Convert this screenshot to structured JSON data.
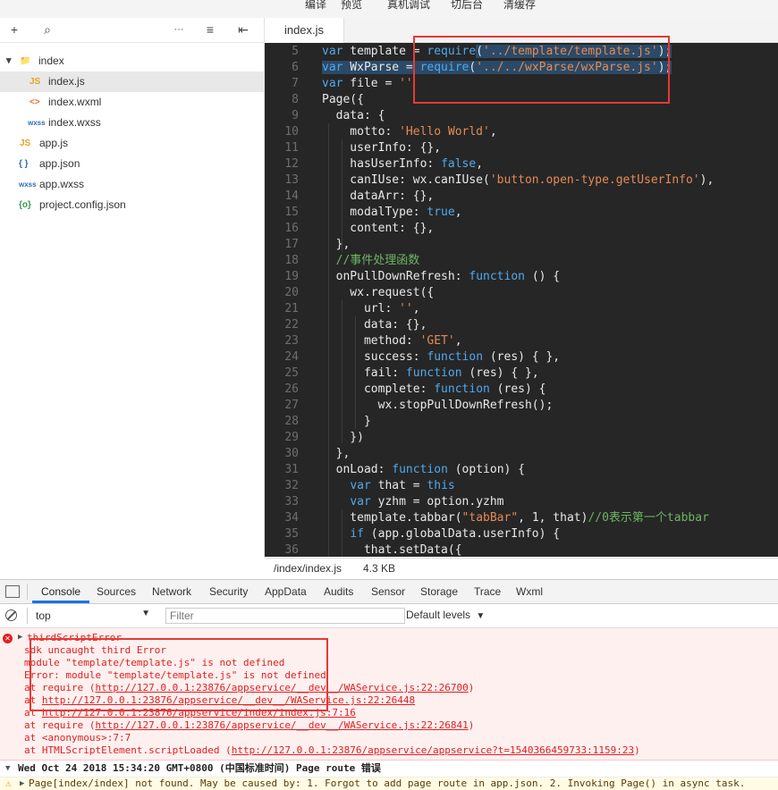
{
  "top_menu": [
    "编译",
    "预览",
    "真机调试",
    "切后台",
    "清缓存"
  ],
  "sidebar": {
    "toolbar": [
      "+",
      "⌕",
      "···",
      "≡",
      "⇤"
    ],
    "tree": [
      {
        "label": "index",
        "icon": "📁",
        "arrow": "▾",
        "icon_color": "#555"
      },
      {
        "label": "index.js",
        "icon": "JS",
        "icon_color": "#e8a21a"
      },
      {
        "label": "index.wxml",
        "icon": "<>",
        "icon_color": "#e0703a"
      },
      {
        "label": "index.wxss",
        "icon": "wxss",
        "icon_color": "#2f6db5"
      },
      {
        "label": "app.js",
        "icon": "JS",
        "icon_color": "#e8a21a"
      },
      {
        "label": "app.json",
        "icon": "{ }",
        "icon_color": "#2f6db5"
      },
      {
        "label": "app.wxss",
        "icon": "wxss",
        "icon_color": "#2f6db5"
      },
      {
        "label": "project.config.json",
        "icon": "{o}",
        "icon_color": "#2f9a4b"
      }
    ]
  },
  "editor": {
    "tab": "index.js",
    "lines": [
      {
        "n": "5",
        "parts": [
          [
            "k",
            "var"
          ],
          [
            "t",
            " template = "
          ],
          [
            "k",
            "require"
          ],
          [
            "t",
            "("
          ],
          [
            "s",
            "'../template/template.js'"
          ],
          [
            "t",
            ");"
          ]
        ]
      },
      {
        "n": "6",
        "parts": [
          [
            "k",
            "var"
          ],
          [
            "t",
            " WxParse = "
          ],
          [
            "k",
            "require"
          ],
          [
            "t",
            "("
          ],
          [
            "s",
            "'../../wxParse/wxParse.js'"
          ],
          [
            "t",
            ");"
          ]
        ]
      },
      {
        "n": "7",
        "parts": [
          [
            "k",
            "var"
          ],
          [
            "t",
            " file = "
          ],
          [
            "s",
            "''"
          ]
        ]
      },
      {
        "n": "8",
        "parts": [
          [
            "t",
            "Page({"
          ]
        ]
      },
      {
        "n": "9",
        "parts": [
          [
            "t",
            "  data: {"
          ]
        ]
      },
      {
        "n": "10",
        "parts": [
          [
            "t",
            "    motto: "
          ],
          [
            "s",
            "'Hello World'"
          ],
          [
            "t",
            ","
          ]
        ]
      },
      {
        "n": "11",
        "parts": [
          [
            "t",
            "    userInfo: {},"
          ]
        ]
      },
      {
        "n": "12",
        "parts": [
          [
            "t",
            "    hasUserInfo: "
          ],
          [
            "k",
            "false"
          ],
          [
            "t",
            ","
          ]
        ]
      },
      {
        "n": "13",
        "parts": [
          [
            "t",
            "    canIUse: wx.canIUse("
          ],
          [
            "s",
            "'button.open-type.getUserInfo'"
          ],
          [
            "t",
            "),"
          ]
        ]
      },
      {
        "n": "14",
        "parts": [
          [
            "t",
            "    dataArr: {},"
          ]
        ]
      },
      {
        "n": "15",
        "parts": [
          [
            "t",
            "    modalType: "
          ],
          [
            "k",
            "true"
          ],
          [
            "t",
            ","
          ]
        ]
      },
      {
        "n": "16",
        "parts": [
          [
            "t",
            "    content: {},"
          ]
        ]
      },
      {
        "n": "17",
        "parts": [
          [
            "t",
            "  },"
          ]
        ]
      },
      {
        "n": "18",
        "parts": [
          [
            "c",
            "  //事件处理函数"
          ]
        ]
      },
      {
        "n": "19",
        "parts": [
          [
            "t",
            "  onPullDownRefresh: "
          ],
          [
            "k",
            "function"
          ],
          [
            "t",
            " () {"
          ]
        ]
      },
      {
        "n": "20",
        "parts": [
          [
            "t",
            "    wx.request({"
          ]
        ]
      },
      {
        "n": "21",
        "parts": [
          [
            "t",
            "      url: "
          ],
          [
            "s",
            "''"
          ],
          [
            "t",
            ","
          ]
        ]
      },
      {
        "n": "22",
        "parts": [
          [
            "t",
            "      data: {},"
          ]
        ]
      },
      {
        "n": "23",
        "parts": [
          [
            "t",
            "      method: "
          ],
          [
            "s",
            "'GET'"
          ],
          [
            "t",
            ","
          ]
        ]
      },
      {
        "n": "24",
        "parts": [
          [
            "t",
            "      success: "
          ],
          [
            "k",
            "function"
          ],
          [
            "t",
            " (res) { },"
          ]
        ]
      },
      {
        "n": "25",
        "parts": [
          [
            "t",
            "      fail: "
          ],
          [
            "k",
            "function"
          ],
          [
            "t",
            " (res) { },"
          ]
        ]
      },
      {
        "n": "26",
        "parts": [
          [
            "t",
            "      complete: "
          ],
          [
            "k",
            "function"
          ],
          [
            "t",
            " (res) {"
          ]
        ]
      },
      {
        "n": "27",
        "parts": [
          [
            "t",
            "        wx.stopPullDownRefresh();"
          ]
        ]
      },
      {
        "n": "28",
        "parts": [
          [
            "t",
            "      }"
          ]
        ]
      },
      {
        "n": "29",
        "parts": [
          [
            "t",
            "    })"
          ]
        ]
      },
      {
        "n": "30",
        "parts": [
          [
            "t",
            "  },"
          ]
        ]
      },
      {
        "n": "31",
        "parts": [
          [
            "t",
            "  onLoad: "
          ],
          [
            "k",
            "function"
          ],
          [
            "t",
            " (option) {"
          ]
        ]
      },
      {
        "n": "32",
        "parts": [
          [
            "t",
            "    "
          ],
          [
            "k",
            "var"
          ],
          [
            "t",
            " that = "
          ],
          [
            "k",
            "this"
          ]
        ]
      },
      {
        "n": "33",
        "parts": [
          [
            "t",
            "    "
          ],
          [
            "k",
            "var"
          ],
          [
            "t",
            " yzhm = option.yzhm"
          ]
        ]
      },
      {
        "n": "34",
        "parts": [
          [
            "t",
            "    template.tabbar("
          ],
          [
            "s",
            "\"tabBar\""
          ],
          [
            "t",
            ", 1, that)"
          ],
          [
            "c",
            "//0表示第一个tabbar"
          ]
        ]
      },
      {
        "n": "35",
        "parts": [
          [
            "t",
            "    "
          ],
          [
            "k",
            "if"
          ],
          [
            "t",
            " (app.globalData.userInfo) {"
          ]
        ]
      },
      {
        "n": "36",
        "parts": [
          [
            "t",
            "      that.setData({"
          ]
        ]
      }
    ]
  },
  "status": {
    "path": "/index/index.js",
    "size": "4.3 KB"
  },
  "devtools": {
    "tabs": [
      "Console",
      "Sources",
      "Network",
      "Security",
      "AppData",
      "Audits",
      "Sensor",
      "Storage",
      "Trace",
      "Wxml"
    ],
    "context": "top",
    "filter_placeholder": "Filter",
    "levels": "Default levels"
  },
  "console": {
    "error_title": "thirdScriptError",
    "error_lines": [
      {
        "text": "sdk uncaught third Error"
      },
      {
        "text": "module \"template/template.js\" is not defined"
      },
      {
        "text": "Error: module \"template/template.js\" is not defined"
      },
      {
        "pre": "    at require (",
        "link": "http://127.0.0.1:23876/appservice/__dev__/WAService.js:22:26700",
        "post": ")"
      },
      {
        "pre": "    at ",
        "link": "http://127.0.0.1:23876/appservice/__dev__/WAService.js:22:26448",
        "post": ""
      },
      {
        "pre": "    at ",
        "link": "http://127.0.0.1:23876/appservice/index/index.js:7:16",
        "post": ""
      },
      {
        "pre": "    at require (",
        "link": "http://127.0.0.1:23876/appservice/__dev__/WAService.js:22:26841",
        "post": ")"
      },
      {
        "text": "    at <anonymous>:7:7"
      },
      {
        "pre": "    at HTMLScriptElement.scriptLoaded (",
        "link": "http://127.0.0.1:23876/appservice/appservice?t=1540366459733:1159:23",
        "post": ")"
      }
    ],
    "route_log": "Wed Oct 24 2018 15:34:20 GMT+0800 (中国标准时间) Page route 错误",
    "warn": "Page[index/index] not found. May be caused by: 1. Forgot to add page route in app.json. 2. Invoking Page() in async task."
  }
}
